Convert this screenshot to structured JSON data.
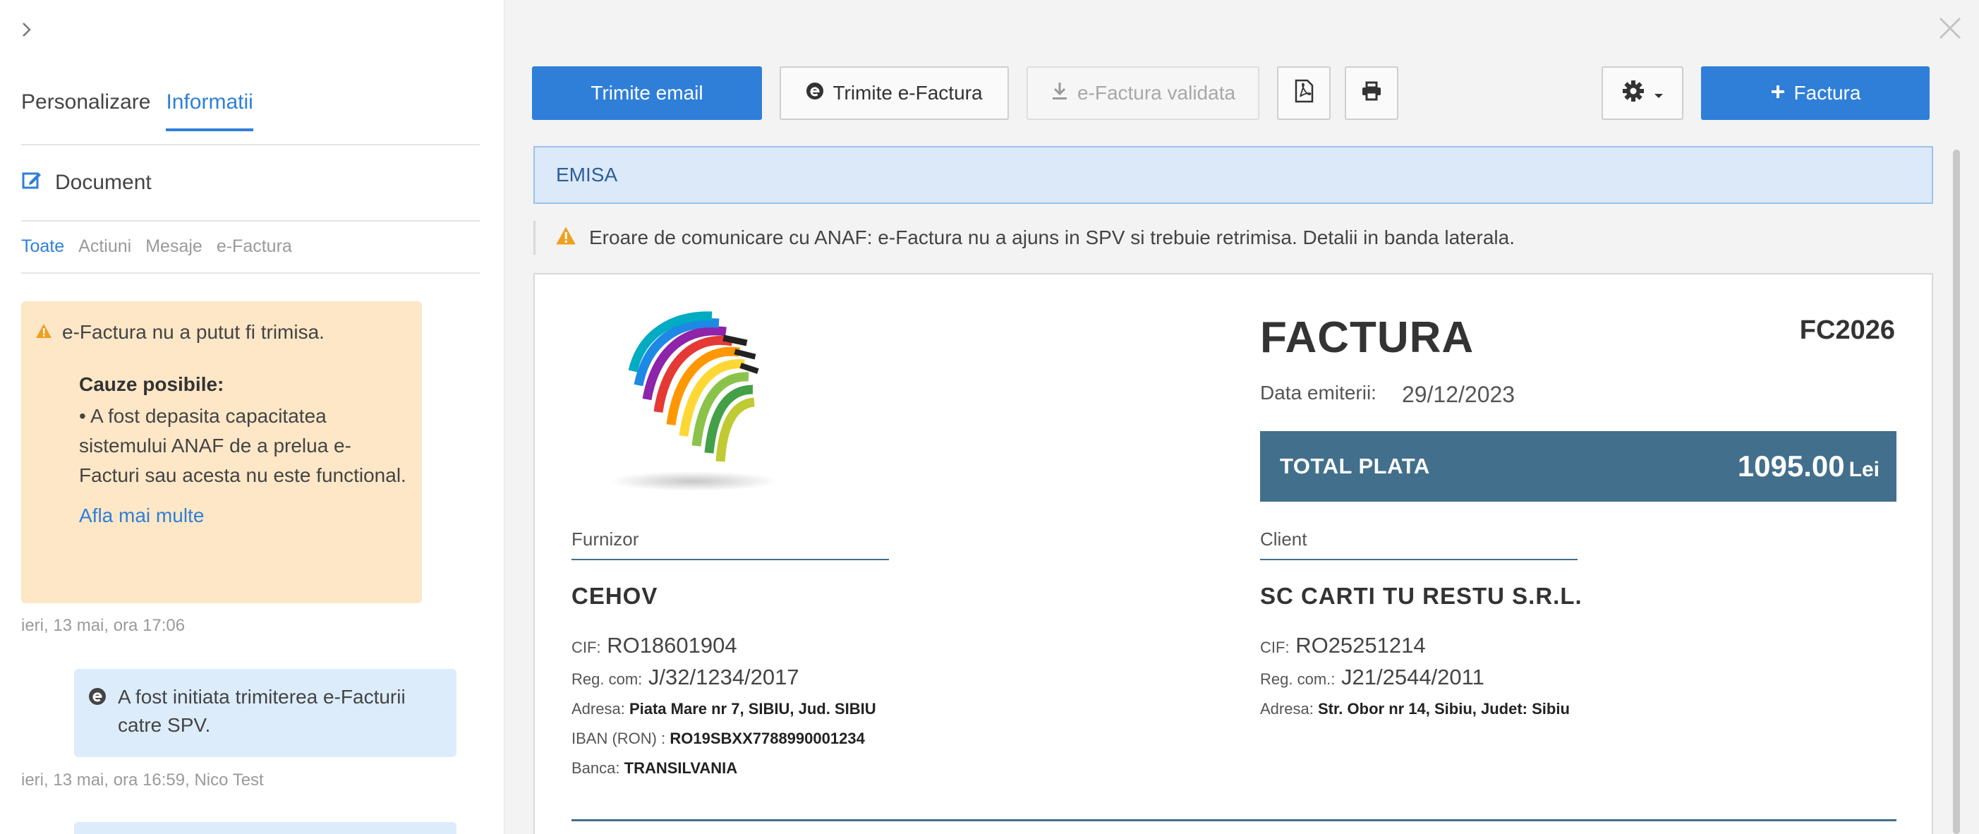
{
  "sidebar": {
    "tabs": [
      {
        "label": "Personalizare",
        "active": false
      },
      {
        "label": "Informatii",
        "active": true
      }
    ],
    "document_label": "Document",
    "filters": [
      {
        "label": "Toate",
        "active": true
      },
      {
        "label": "Actiuni",
        "active": false
      },
      {
        "label": "Mesaje",
        "active": false
      },
      {
        "label": "e-Factura",
        "active": false
      }
    ],
    "warning": {
      "title": "e-Factura nu a putut fi trimisa.",
      "causes_title": "Cauze posibile:",
      "cause": "• A fost depasita capacitatea sistemului ANAF de a prelua e-Facturi sau acesta nu este functional.",
      "link": "Afla mai multe",
      "timestamp": "ieri, 13 mai, ora 17:06"
    },
    "info": {
      "text": "A fost initiata trimiterea e-Facturii catre SPV.",
      "timestamp": "ieri, 13 mai, ora 16:59, Nico Test"
    }
  },
  "toolbar": {
    "send_email": "Trimite email",
    "send_efactura": "Trimite e-Factura",
    "efactura_validated": "e-Factura validata",
    "new_invoice": "Factura"
  },
  "status": {
    "label": "EMISA",
    "alert": "Eroare de comunicare cu ANAF: e-Factura nu a ajuns in SPV si trebuie retrimisa. Detalii in banda laterala."
  },
  "invoice": {
    "title": "FACTURA",
    "number": "FC2026",
    "date_label": "Data emiterii:",
    "date": "29/12/2023",
    "total_label": "TOTAL PLATA",
    "total_amount": "1095.00",
    "currency": "Lei",
    "supplier": {
      "label": "Furnizor",
      "name": "CEHOV",
      "cif_label": "CIF:",
      "cif": "RO18601904",
      "reg_label": "Reg. com:",
      "reg": "J/32/1234/2017",
      "address_label": "Adresa:",
      "address": "Piata Mare nr 7, SIBIU, Jud. SIBIU",
      "iban_label": "IBAN (RON) :",
      "iban": "RO19SBXX7788990001234",
      "bank_label": "Banca:",
      "bank": "TRANSILVANIA"
    },
    "client": {
      "label": "Client",
      "name": "SC CARTI TU RESTU S.R.L.",
      "cif_label": "CIF:",
      "cif": "RO25251214",
      "reg_label": "Reg. com.:",
      "reg": "J21/2544/2011",
      "address_label": "Adresa:",
      "address": "Str. Obor nr 14, Sibiu, Judet: Sibiu"
    }
  },
  "colors": {
    "accent": "#2f7fd8",
    "warning_bg": "#fde7c7",
    "warning_icon": "#f0a020",
    "status_bg": "#dbe9f9",
    "total_bar": "#426f8b"
  }
}
